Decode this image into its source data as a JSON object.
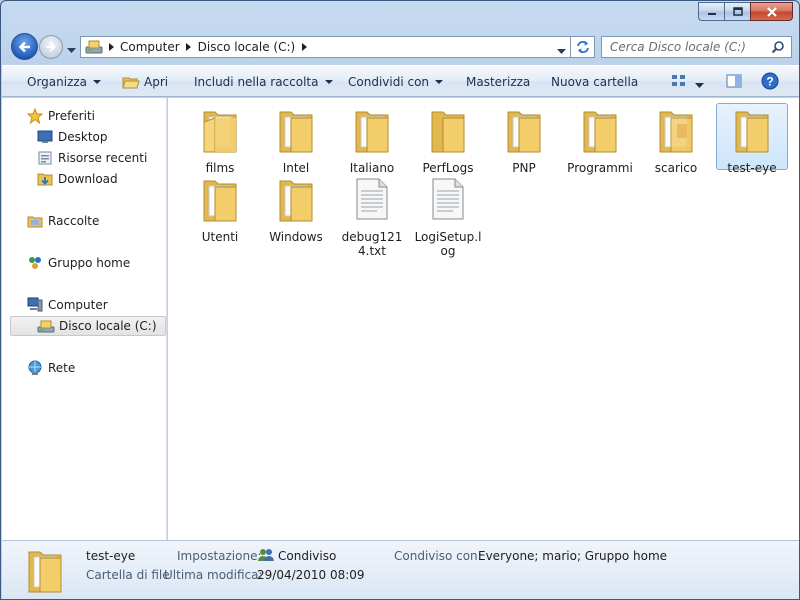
{
  "address": {
    "crumbs": [
      "Computer",
      "Disco locale (C:)"
    ]
  },
  "search": {
    "placeholder": "Cerca Disco locale (C:)"
  },
  "commandbar": {
    "organizza": "Organizza",
    "apri": "Apri",
    "includi": "Includi nella raccolta",
    "condividi": "Condividi con",
    "masterizza": "Masterizza",
    "nuova_cartella": "Nuova cartella"
  },
  "navpane": {
    "preferiti": "Preferiti",
    "desktop": "Desktop",
    "risorse_recenti": "Risorse recenti",
    "download": "Download",
    "raccolte": "Raccolte",
    "gruppo_home": "Gruppo home",
    "computer": "Computer",
    "disco_locale": "Disco locale (C:)",
    "rete": "Rete"
  },
  "items": [
    {
      "name": "films",
      "kind": "folder"
    },
    {
      "name": "Intel",
      "kind": "folder"
    },
    {
      "name": "Italiano",
      "kind": "folder"
    },
    {
      "name": "PerfLogs",
      "kind": "folder"
    },
    {
      "name": "PNP",
      "kind": "folder"
    },
    {
      "name": "Programmi",
      "kind": "folder"
    },
    {
      "name": "scarico",
      "kind": "folder"
    },
    {
      "name": "test-eye",
      "kind": "folder",
      "selected": true
    },
    {
      "name": "Utenti",
      "kind": "folder"
    },
    {
      "name": "Windows",
      "kind": "folder"
    },
    {
      "name": "debug1214.txt",
      "kind": "file"
    },
    {
      "name": "LogiSetup.log",
      "kind": "file"
    }
  ],
  "details": {
    "name": "test-eye",
    "type": "Cartella di file",
    "impostazione_label": "Impostazione:",
    "impostazione_value": "Condiviso",
    "condiviso_label": "Condiviso con:",
    "condiviso_value": "Everyone; mario; Gruppo home",
    "modifica_label": "Ultima modifica:",
    "modifica_value": "29/04/2010 08:09"
  },
  "colors": {
    "folder": "#f0cf6b",
    "selection": "#cde5fb",
    "accent": "#1f5dbb"
  }
}
